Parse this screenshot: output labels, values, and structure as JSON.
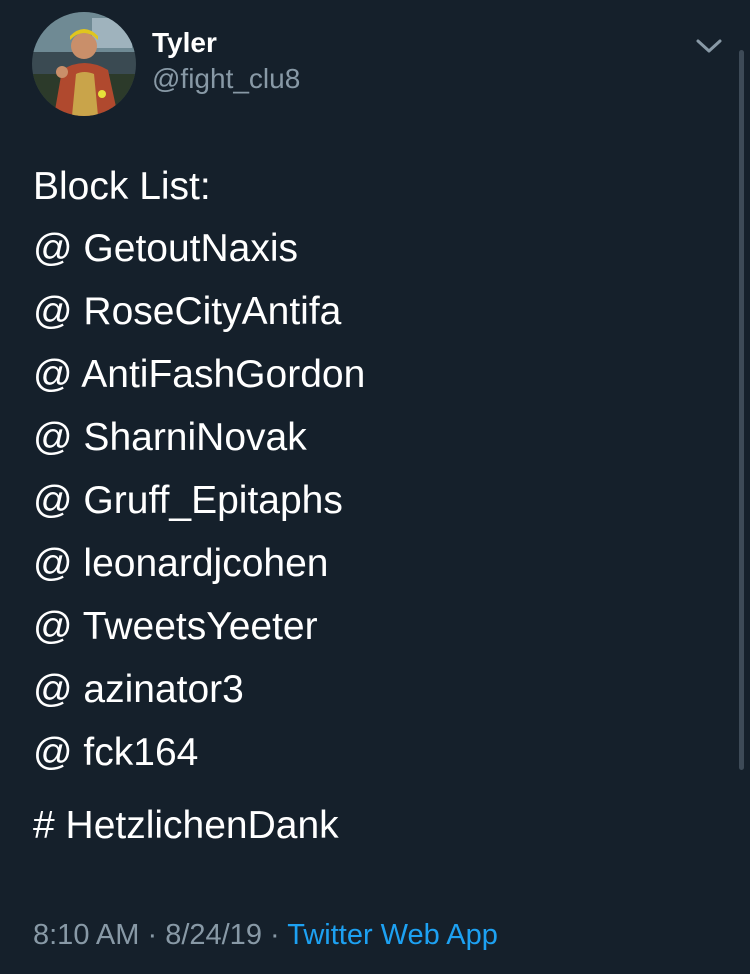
{
  "author": {
    "name": "Tyler",
    "handle": "@fight_clu8",
    "avatar_icon": "profile-photo"
  },
  "menu": {
    "icon": "chevron-down-icon"
  },
  "tweet": {
    "heading": "Block List:",
    "mentions": [
      "@ GetoutNaxis",
      "@ RoseCityAntifa",
      "@ AntiFashGordon",
      "@ SharniNovak",
      "@ Gruff_Epitaphs",
      "@ leonardjcohen",
      "@ TweetsYeeter",
      "@ azinator3",
      "@ fck164"
    ],
    "hashtag": "# HetzlichenDank"
  },
  "meta": {
    "time": "8:10 AM",
    "sep1": " · ",
    "date": "8/24/19",
    "sep2": " · ",
    "source": "Twitter Web App"
  },
  "colors": {
    "background": "#15202b",
    "text": "#ffffff",
    "secondary": "#8899a6",
    "link": "#1da1f2"
  }
}
